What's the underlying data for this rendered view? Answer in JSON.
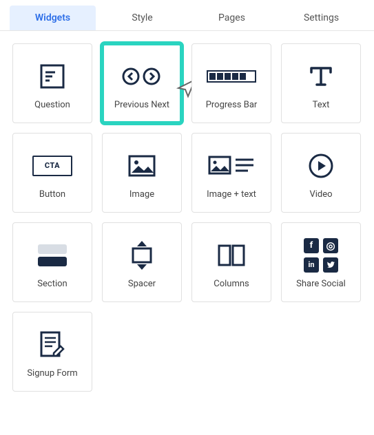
{
  "tabs": [
    {
      "label": "Widgets",
      "active": true
    },
    {
      "label": "Style",
      "active": false
    },
    {
      "label": "Pages",
      "active": false
    },
    {
      "label": "Settings",
      "active": false
    }
  ],
  "widgets": {
    "question": {
      "label": "Question"
    },
    "prev_next": {
      "label": "Previous Next"
    },
    "progress_bar": {
      "label": "Progress Bar"
    },
    "text": {
      "label": "Text"
    },
    "button": {
      "label": "Button",
      "cta_text": "CTA"
    },
    "image": {
      "label": "Image"
    },
    "image_text": {
      "label": "Image + text"
    },
    "video": {
      "label": "Video"
    },
    "section": {
      "label": "Section"
    },
    "spacer": {
      "label": "Spacer"
    },
    "columns": {
      "label": "Columns"
    },
    "share_social": {
      "label": "Share Social"
    },
    "signup_form": {
      "label": "Signup Form"
    }
  },
  "highlighted_widget": "prev_next"
}
